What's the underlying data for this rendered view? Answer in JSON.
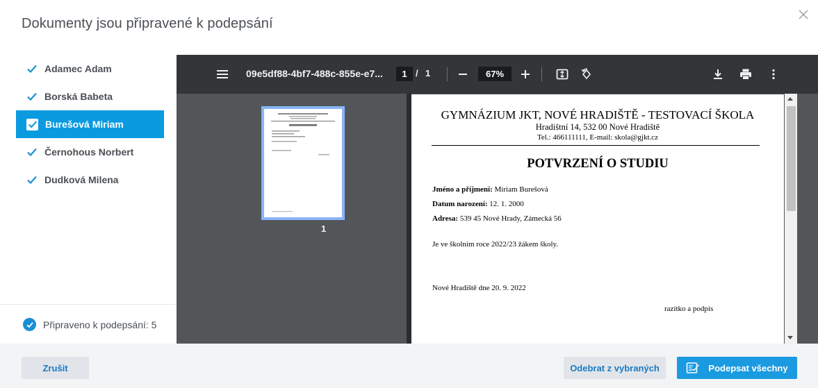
{
  "dialog": {
    "title": "Dokumenty jsou připravené k podepsání",
    "close_icon": "close-icon"
  },
  "people": [
    {
      "name": "Adamec Adam",
      "checked": true,
      "selected": false
    },
    {
      "name": "Borská Babeta",
      "checked": true,
      "selected": false
    },
    {
      "name": "Burešová Miriam",
      "checked": true,
      "selected": true
    },
    {
      "name": "Černohous Norbert",
      "checked": true,
      "selected": false
    },
    {
      "name": "Dudková Milena",
      "checked": true,
      "selected": false
    }
  ],
  "ready": {
    "label": "Připraveno k podepsání: 5"
  },
  "viewer": {
    "file_name": "09e5df88-4bf7-488c-855e-e7...",
    "current_page": "1",
    "separator": "/",
    "total_pages": "1",
    "zoom": "67%",
    "thumbnail_label": "1",
    "icons": [
      "menu-icon",
      "zoom-out-icon",
      "zoom-in-icon",
      "fit-page-icon",
      "rotate-icon",
      "download-icon",
      "print-icon",
      "more-icon"
    ]
  },
  "document": {
    "school": "GYMNÁZIUM JKT, NOVÉ HRADIŠTĚ - TESTOVACÍ ŠKOLA",
    "address": "Hradištní 14, 532 00 Nové Hradiště",
    "contact": "Tel.: 466111111, E-mail: skola@gjkt.cz",
    "heading": "POTVRZENÍ O STUDIU",
    "name_label": "Jméno a příjmení:",
    "name_value": "Miriam Burešová",
    "dob_label": "Datum narození:",
    "dob_value": "12. 1. 2000",
    "address_label": "Adresa:",
    "address_value": "539 45 Nové Hrady, Zámecká 56",
    "statement": "Je ve školním roce 2022/23 žákem školy.",
    "place_date": "Nové Hradiště dne 20. 9. 2022",
    "stamp": "razítko a podpis"
  },
  "footer": {
    "cancel": "Zrušit",
    "remove_selected": "Odebrat z vybraných",
    "sign_all": "Podepsat všechny"
  },
  "colors": {
    "accent": "#1a9ae0",
    "viewer_bg": "#525659",
    "toolbar_bg": "#323639"
  }
}
